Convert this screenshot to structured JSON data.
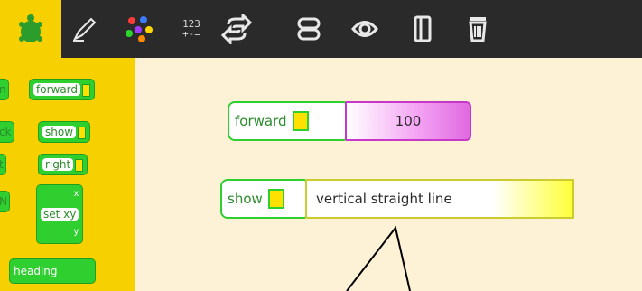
{
  "toolbar": {
    "number_icon_top": "123",
    "number_icon_bottom": "+-=",
    "icons": [
      "turtle-icon",
      "pen-icon",
      "colors-icon",
      "numbers-icon",
      "flow-icon",
      "blocks-icon",
      "sensors-icon",
      "media-icon",
      "trash-icon"
    ]
  },
  "palette": {
    "forward_label": "forward",
    "show_label": "show",
    "right_label": "right",
    "setxy_label": "set xy",
    "setxy_x": "x",
    "setxy_y": "y",
    "heading_label": "heading",
    "partial_n": "n",
    "partial_ck": "ck",
    "partial_t": "t",
    "partial_n2": "N"
  },
  "canvas": {
    "forward_block": {
      "label": "forward",
      "arg": "100"
    },
    "show_block": {
      "label": "show",
      "arg": "vertical straight line"
    }
  },
  "colors": {
    "toolbar_bg": "#2a2a2a",
    "palette_bg": "#f7d000",
    "canvas_bg": "#fdf1d6",
    "block_green": "#2fcf2f",
    "number_magenta": "#e06ae0",
    "string_yellow": "#ffff3a"
  }
}
